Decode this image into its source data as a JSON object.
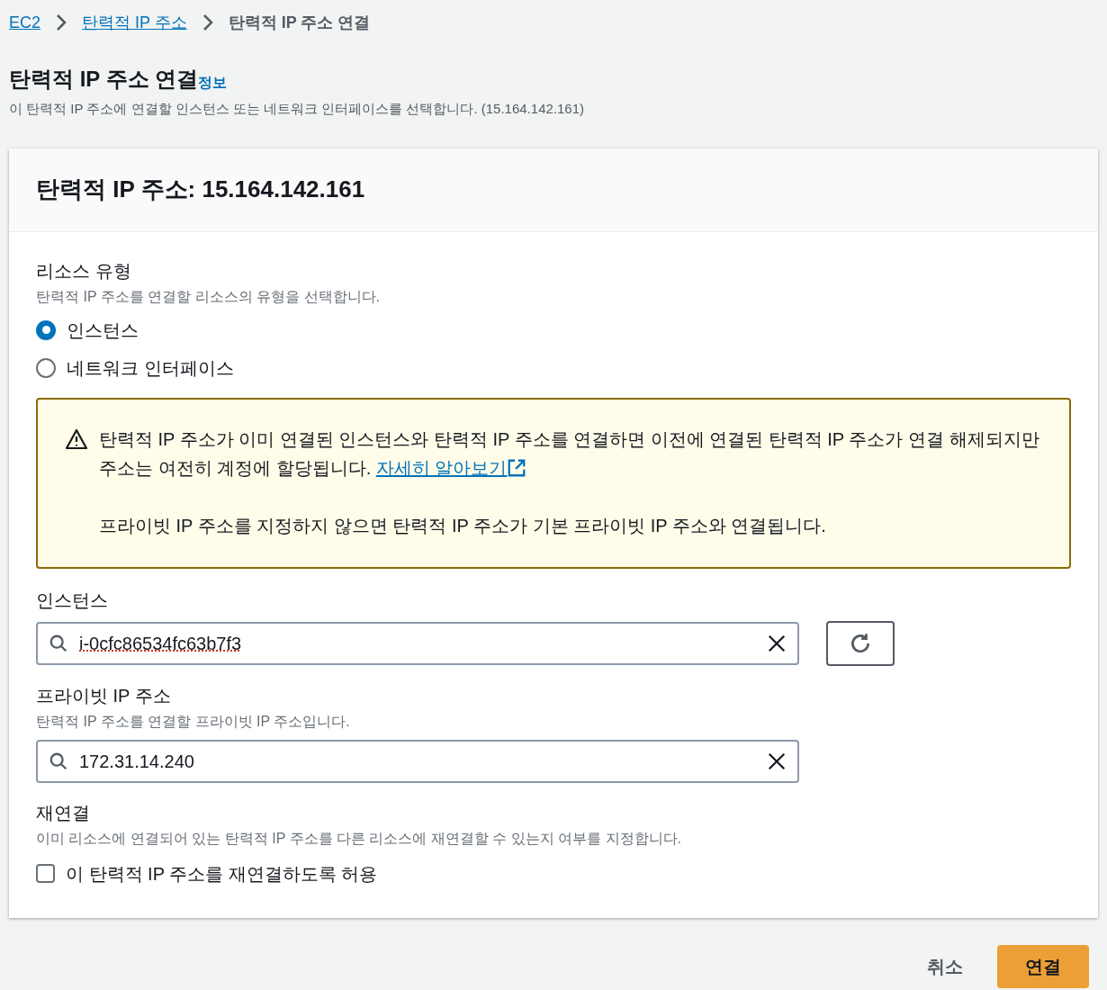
{
  "breadcrumb": [
    {
      "label": "EC2",
      "link": true
    },
    {
      "label": "탄력적 IP 주소",
      "link": true
    },
    {
      "label": "탄력적 IP 주소 연결",
      "link": false
    }
  ],
  "page": {
    "title": "탄력적 IP 주소 연결",
    "info": "정보",
    "description": "이 탄력적 IP 주소에 연결할 인스턴스 또는 네트워크 인터페이스를 선택합니다. (15.164.142.161)"
  },
  "card": {
    "title": "탄력적 IP 주소: 15.164.142.161",
    "resource_type": {
      "label": "리소스 유형",
      "description": "탄력적 IP 주소를 연결할 리소스의 유형을 선택합니다.",
      "options": [
        {
          "label": "인스턴스",
          "selected": true
        },
        {
          "label": "네트워크 인터페이스",
          "selected": false
        }
      ]
    },
    "warning": {
      "text": "탄력적 IP 주소가 이미 연결된 인스턴스와 탄력적 IP 주소를 연결하면 이전에 연결된 탄력적 IP 주소가 연결 해제되지만 주소는 여전히 계정에 할당됩니다.",
      "link": "자세히 알아보기",
      "note": "프라이빗 IP 주소를 지정하지 않으면 탄력적 IP 주소가 기본 프라이빗 IP 주소와 연결됩니다."
    },
    "instance": {
      "label": "인스턴스",
      "value": "i-0cfc86534fc63b7f3"
    },
    "private_ip": {
      "label": "프라이빗 IP 주소",
      "description": "탄력적 IP 주소를 연결할 프라이빗 IP 주소입니다.",
      "value": "172.31.14.240"
    },
    "reassociate": {
      "label": "재연결",
      "description": "이미 리소스에 연결되어 있는 탄력적 IP 주소를 다른 리소스에 재연결할 수 있는지 여부를 지정합니다.",
      "checkbox": "이 탄력적 IP 주소를 재연결하도록 허용",
      "checked": false
    }
  },
  "buttons": {
    "cancel": "취소",
    "submit": "연결"
  }
}
